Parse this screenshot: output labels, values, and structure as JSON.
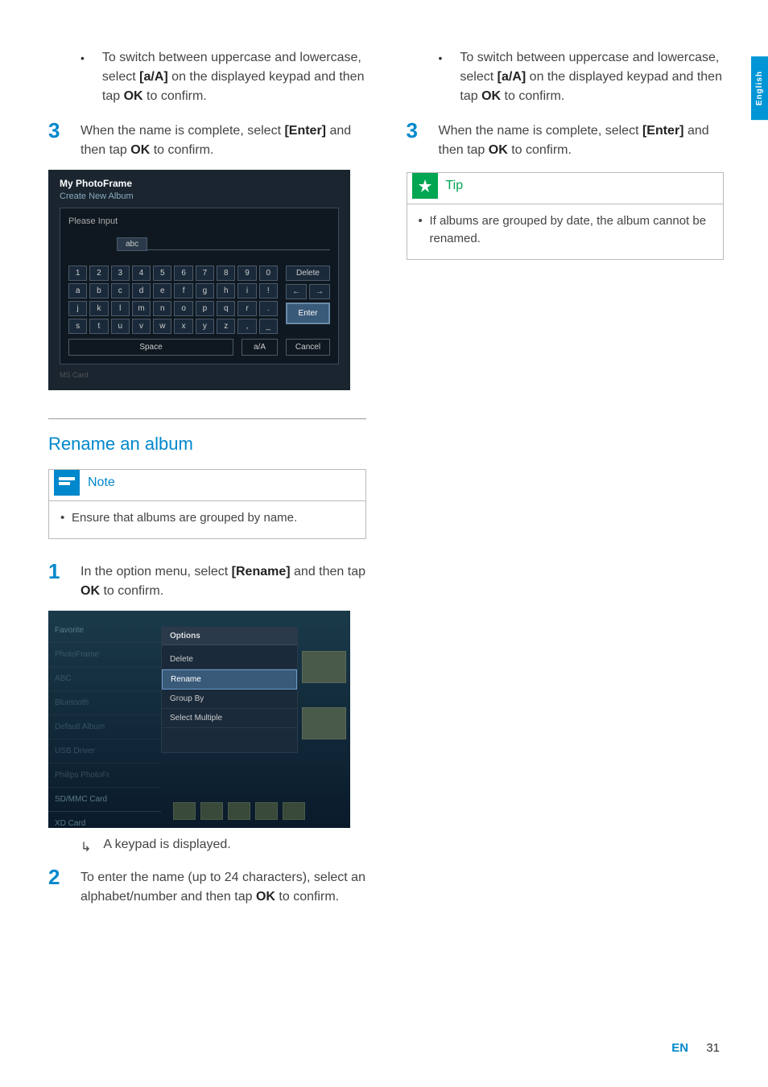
{
  "sideTab": "English",
  "col1": {
    "bullet1_pre": "To switch between uppercase and lowercase, select ",
    "bullet1_bold1": "[a/A]",
    "bullet1_mid": " on the displayed keypad and then tap ",
    "bullet1_bold2": "OK",
    "bullet1_post": " to confirm.",
    "step3_num": "3",
    "step3_pre": "When the name is complete, select ",
    "step3_bold1": "[Enter]",
    "step3_mid": " and then tap ",
    "step3_bold2": "OK",
    "step3_post": " to confirm.",
    "sectionTitle": "Rename an album",
    "noteLabel": "Note",
    "noteBody": "Ensure that albums are grouped by name.",
    "step1_num": "1",
    "step1_pre": "In the option menu, select ",
    "step1_bold1": "[Rename]",
    "step1_mid": " and then tap ",
    "step1_bold2": "OK",
    "step1_post": " to confirm.",
    "result1": "A keypad is displayed.",
    "step2_num": "2",
    "step2_pre": "To enter the name (up to 24 characters), select an alphabet/number and then tap ",
    "step2_bold1": "OK",
    "step2_post": " to confirm."
  },
  "col2": {
    "bullet1_pre": "To switch between uppercase and lowercase, select ",
    "bullet1_bold1": "[a/A]",
    "bullet1_mid": " on the displayed keypad and then tap ",
    "bullet1_bold2": "OK",
    "bullet1_post": " to confirm.",
    "step3_num": "3",
    "step3_pre": "When the name is complete, select ",
    "step3_bold1": "[Enter]",
    "step3_mid": " and then tap ",
    "step3_bold2": "OK",
    "step3_post": " to confirm.",
    "tipLabel": "Tip",
    "tipBody": "If albums are grouped by date, the album cannot be renamed."
  },
  "screenshot1": {
    "title": "My PhotoFrame",
    "subtitle": "Create New Album",
    "inputLabel": "Please Input",
    "inputValue": "abc",
    "row1": [
      "1",
      "2",
      "3",
      "4",
      "5",
      "6",
      "7",
      "8",
      "9",
      "0"
    ],
    "row2": [
      "a",
      "b",
      "c",
      "d",
      "e",
      "f",
      "g",
      "h",
      "i",
      "!"
    ],
    "row3": [
      "j",
      "k",
      "l",
      "m",
      "n",
      "o",
      "p",
      "q",
      "r",
      "."
    ],
    "row4": [
      "s",
      "t",
      "u",
      "v",
      "w",
      "x",
      "y",
      "z",
      ",",
      "_"
    ],
    "delete": "Delete",
    "arrowLeft": "←",
    "arrowRight": "→",
    "enter": "Enter",
    "space": "Space",
    "aA": "a/A",
    "cancel": "Cancel",
    "footerText": "MS Card"
  },
  "screenshot2": {
    "leftItems": [
      "Favorite",
      "PhotoFrame",
      "ABC",
      "Bluetooth",
      "Default Album",
      "USB Driver",
      "Philips PhotoFr",
      "SD/MMC Card",
      "XD Card"
    ],
    "optionsHeader": "Options",
    "options": [
      "Delete",
      "Rename",
      "Group By",
      "Select Multiple"
    ],
    "selectedIndex": 1
  },
  "footer": {
    "lang": "EN",
    "page": "31"
  }
}
